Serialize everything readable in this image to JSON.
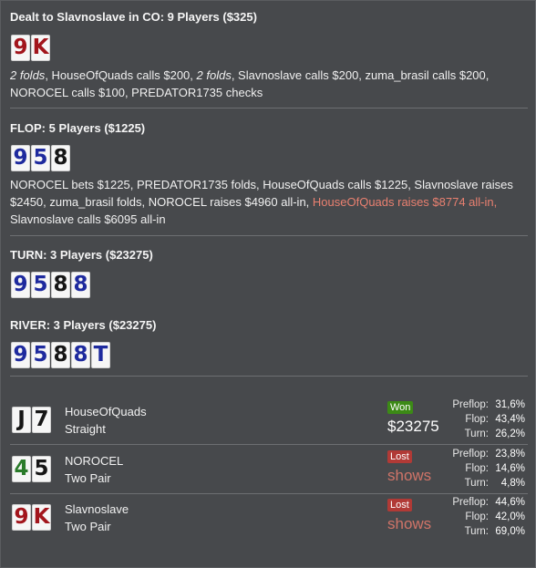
{
  "preflop": {
    "title": "Dealt to Slavnoslave in CO: 9 Players ($325)",
    "cards": [
      {
        "r": "9",
        "color": "red"
      },
      {
        "r": "K",
        "color": "red"
      }
    ],
    "line1_a": "2 folds",
    "line1_b": ", HouseOfQuads calls $200, ",
    "line1_c": "2 folds",
    "line1_d": ", Slavnoslave calls $200, zuma_brasil calls $200,",
    "line2": "NOROCEL calls $100, PREDATOR1735 checks"
  },
  "flop": {
    "title": "FLOP: 5 Players ($1225)",
    "cards": [
      {
        "r": "9",
        "color": "blue"
      },
      {
        "r": "5",
        "color": "blue"
      },
      {
        "r": "8",
        "color": "black"
      }
    ],
    "line1": "NOROCEL bets $1225, PREDATOR1735 folds, HouseOfQuads calls $1225, Slavnoslave raises",
    "line2_a": "$2450, zuma_brasil folds, NOROCEL raises $4960 all-in, ",
    "line2_b": "HouseOfQuads raises $8774 all-in,",
    "line3": "Slavnoslave calls $6095 all-in"
  },
  "turn": {
    "title": "TURN: 3 Players ($23275)",
    "cards": [
      {
        "r": "9",
        "color": "blue"
      },
      {
        "r": "5",
        "color": "blue"
      },
      {
        "r": "8",
        "color": "black"
      },
      {
        "r": "8",
        "color": "blue"
      }
    ]
  },
  "river": {
    "title": "RIVER: 3 Players ($23275)",
    "cards": [
      {
        "r": "9",
        "color": "blue"
      },
      {
        "r": "5",
        "color": "blue"
      },
      {
        "r": "8",
        "color": "black"
      },
      {
        "r": "8",
        "color": "blue"
      },
      {
        "r": "T",
        "color": "blue"
      }
    ]
  },
  "results": [
    {
      "cards": [
        {
          "r": "J",
          "color": "black"
        },
        {
          "r": "7",
          "color": "black"
        }
      ],
      "name": "HouseOfQuads",
      "hand": "Straight",
      "status": "Won",
      "amount": "$23275",
      "stats": [
        {
          "k": "Preflop:",
          "v": "31,6%"
        },
        {
          "k": "Flop:",
          "v": "43,4%"
        },
        {
          "k": "Turn:",
          "v": "26,2%"
        }
      ]
    },
    {
      "cards": [
        {
          "r": "4",
          "color": "green"
        },
        {
          "r": "5",
          "color": "black"
        }
      ],
      "name": "NOROCEL",
      "hand": "Two Pair",
      "status": "Lost",
      "amount": "shows",
      "stats": [
        {
          "k": "Preflop:",
          "v": "23,8%"
        },
        {
          "k": "Flop:",
          "v": "14,6%"
        },
        {
          "k": "Turn:",
          "v": "4,8%"
        }
      ]
    },
    {
      "cards": [
        {
          "r": "9",
          "color": "red"
        },
        {
          "r": "K",
          "color": "red"
        }
      ],
      "name": "Slavnoslave",
      "hand": "Two Pair",
      "status": "Lost",
      "amount": "shows",
      "stats": [
        {
          "k": "Preflop:",
          "v": "44,6%"
        },
        {
          "k": "Flop:",
          "v": "42,0%"
        },
        {
          "k": "Turn:",
          "v": "69,0%"
        }
      ]
    }
  ],
  "colors": {
    "red": "#a2151c",
    "blue": "#1e2a9e",
    "black": "#161616",
    "green": "#2a7b2a"
  }
}
